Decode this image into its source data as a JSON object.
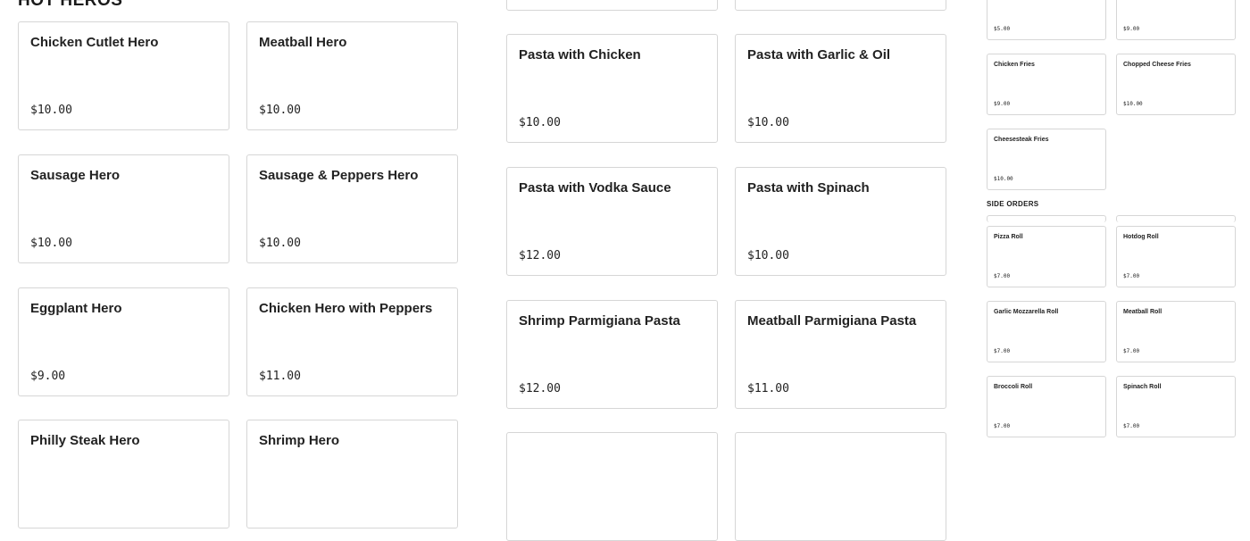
{
  "heroes": {
    "title": "HOT HEROS",
    "items": [
      {
        "name": "Chicken Cutlet Hero",
        "price": "$10.00"
      },
      {
        "name": "Meatball Hero",
        "price": "$10.00"
      },
      {
        "name": "Sausage Hero",
        "price": "$10.00"
      },
      {
        "name": "Sausage & Peppers Hero",
        "price": "$10.00"
      },
      {
        "name": "Eggplant Hero",
        "price": "$9.00"
      },
      {
        "name": "Chicken Hero with Peppers",
        "price": "$11.00"
      },
      {
        "name": "Philly Steak Hero",
        "price": ""
      },
      {
        "name": "Shrimp Hero",
        "price": ""
      }
    ]
  },
  "pasta": {
    "items": [
      {
        "name": "",
        "price": ""
      },
      {
        "name": "",
        "price": ""
      },
      {
        "name": "Pasta with Chicken",
        "price": "$10.00"
      },
      {
        "name": "Pasta with Garlic & Oil",
        "price": "$10.00"
      },
      {
        "name": "Pasta with Vodka Sauce",
        "price": "$12.00"
      },
      {
        "name": "Pasta with Spinach",
        "price": "$10.00"
      },
      {
        "name": "Shrimp Parmigiana Pasta",
        "price": "$12.00"
      },
      {
        "name": "Meatball Parmigiana Pasta",
        "price": "$11.00"
      },
      {
        "name": "",
        "price": ""
      },
      {
        "name": "",
        "price": ""
      }
    ]
  },
  "fries": {
    "items": [
      {
        "name": "",
        "price": "$5.00"
      },
      {
        "name": "",
        "price": "$9.00"
      },
      {
        "name": "Chicken Fries",
        "price": "$9.00"
      },
      {
        "name": "Chopped Cheese Fries",
        "price": "$10.00"
      },
      {
        "name": "Cheesesteak Fries",
        "price": "$10.00"
      }
    ]
  },
  "side_orders": {
    "title": "SIDE ORDERS",
    "items": [
      {
        "name": "Pizza Roll",
        "price": "$7.00"
      },
      {
        "name": "Hotdog Roll",
        "price": "$7.00"
      },
      {
        "name": "Garlic Mozzarella Roll",
        "price": "$7.00"
      },
      {
        "name": "Meatball Roll",
        "price": "$7.00"
      },
      {
        "name": "Broccoli Roll",
        "price": "$7.00"
      },
      {
        "name": "Spinach Roll",
        "price": "$7.00"
      }
    ]
  }
}
